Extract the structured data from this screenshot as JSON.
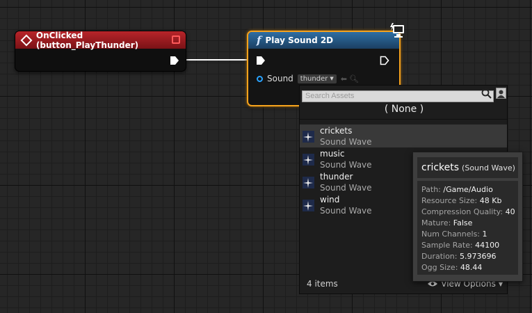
{
  "event_node": {
    "title": "OnClicked (button_PlayThunder)",
    "header_color": "#a01c20"
  },
  "play_node": {
    "title": "Play Sound 2D",
    "func_symbol": "f",
    "pin_label": "Sound",
    "selected_asset": "thunder",
    "header_color": "#2a5f8f",
    "highlight_color": "#f6a21c"
  },
  "asset_picker": {
    "search_placeholder": "Search Assets",
    "none_label": "( None )",
    "items": [
      {
        "name": "crickets",
        "type": "Sound Wave",
        "icon": "sound-wave-icon"
      },
      {
        "name": "music",
        "type": "Sound Wave",
        "icon": "sound-wave-icon"
      },
      {
        "name": "thunder",
        "type": "Sound Wave",
        "icon": "sound-wave-icon"
      },
      {
        "name": "wind",
        "type": "Sound Wave",
        "icon": "sound-wave-icon"
      }
    ],
    "count_label": "4 items",
    "view_options_label": "View Options"
  },
  "tooltip": {
    "name": "crickets",
    "kind": "(Sound Wave)",
    "rows": [
      {
        "label": "Path:",
        "value": "/Game/Audio"
      },
      {
        "label": "Resource Size:",
        "value": "48 Kb"
      },
      {
        "label": "Compression Quality:",
        "value": "40"
      },
      {
        "label": "Mature:",
        "value": "False"
      },
      {
        "label": "Num Channels:",
        "value": "1"
      },
      {
        "label": "Sample Rate:",
        "value": "44100"
      },
      {
        "label": "Duration:",
        "value": "5.973696"
      },
      {
        "label": "Ogg Size:",
        "value": "48.44"
      }
    ]
  }
}
